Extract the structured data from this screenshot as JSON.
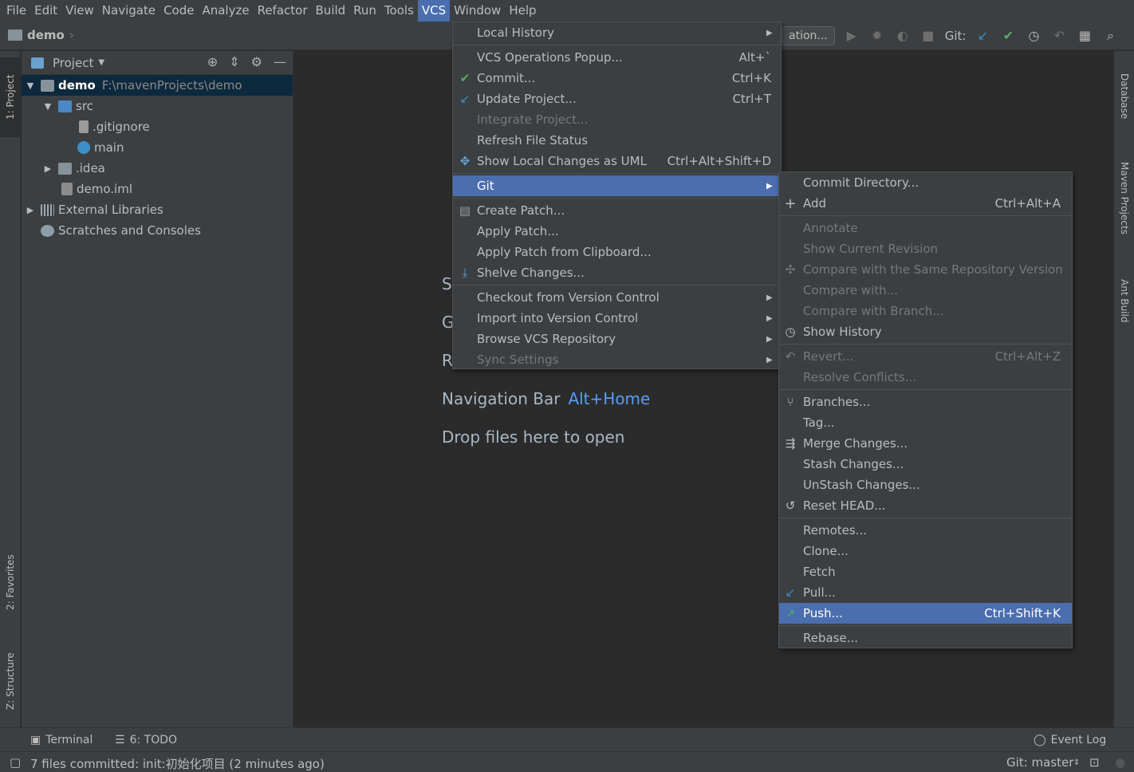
{
  "menubar": [
    "File",
    "Edit",
    "View",
    "Navigate",
    "Code",
    "Analyze",
    "Refactor",
    "Build",
    "Run",
    "Tools",
    "VCS",
    "Window",
    "Help"
  ],
  "menubar_active": "VCS",
  "breadcrumb": {
    "project": "demo"
  },
  "toolbar": {
    "run_config": "ation...",
    "git_label": "Git:"
  },
  "left_tabs": {
    "project": "1: Project",
    "favorites": "2: Favorites",
    "structure": "Z: Structure"
  },
  "right_tabs": {
    "database": "Database",
    "maven": "Maven Projects",
    "ant": "Ant Build"
  },
  "project_panel": {
    "title": "Project",
    "tree": [
      {
        "name": "demo",
        "path": "F:\\mavenProjects\\demo"
      },
      {
        "name": "src"
      },
      {
        "name": ".gitignore"
      },
      {
        "name": "main"
      },
      {
        "name": ".idea"
      },
      {
        "name": "demo.iml"
      },
      {
        "name": "External Libraries"
      },
      {
        "name": "Scratches and Consoles"
      }
    ]
  },
  "editor_hints": {
    "partial_s": "S",
    "partial_g": "G",
    "partial_r": "R",
    "nav_bar": "Navigation Bar",
    "nav_bar_key": "Alt+Home",
    "drop": "Drop files here to open"
  },
  "vcs_menu": {
    "local_history": "Local History",
    "ops_popup": "VCS Operations Popup...",
    "ops_popup_sc": "Alt+`",
    "commit": "Commit...",
    "commit_sc": "Ctrl+K",
    "update": "Update Project...",
    "update_sc": "Ctrl+T",
    "integrate": "Integrate Project...",
    "refresh": "Refresh File Status",
    "uml": "Show Local Changes as UML",
    "uml_sc": "Ctrl+Alt+Shift+D",
    "git": "Git",
    "create_patch": "Create Patch...",
    "apply_patch": "Apply Patch...",
    "apply_clip": "Apply Patch from Clipboard...",
    "shelve": "Shelve Changes...",
    "checkout": "Checkout from Version Control",
    "import": "Import into Version Control",
    "browse": "Browse VCS Repository",
    "sync": "Sync Settings"
  },
  "git_menu": {
    "commit_dir": "Commit Directory...",
    "add": "Add",
    "add_sc": "Ctrl+Alt+A",
    "annotate": "Annotate",
    "show_rev": "Show Current Revision",
    "compare_same": "Compare with the Same Repository Version",
    "compare_with": "Compare with...",
    "compare_branch": "Compare with Branch...",
    "show_history": "Show History",
    "revert": "Revert...",
    "revert_sc": "Ctrl+Alt+Z",
    "resolve": "Resolve Conflicts...",
    "branches": "Branches...",
    "tag": "Tag...",
    "merge": "Merge Changes...",
    "stash": "Stash Changes...",
    "unstash": "UnStash Changes...",
    "reset": "Reset HEAD...",
    "remotes": "Remotes...",
    "clone": "Clone...",
    "fetch": "Fetch",
    "pull": "Pull...",
    "push": "Push...",
    "push_sc": "Ctrl+Shift+K",
    "rebase": "Rebase..."
  },
  "bottom_tabs": {
    "terminal": "Terminal",
    "todo": "6: TODO",
    "event_log": "Event Log"
  },
  "status": {
    "message": "7 files committed: init:初始化项目 (2 minutes ago)",
    "git_branch": "Git: master"
  },
  "colors": {
    "accent": "#4b6eaf",
    "check_green": "#59a869",
    "update_blue": "#3592c4",
    "link_blue": "#589df6"
  },
  "icons": [
    "search-icon",
    "gear-icon",
    "checkmark-icon",
    "arrow-icon",
    "folder-icon"
  ]
}
